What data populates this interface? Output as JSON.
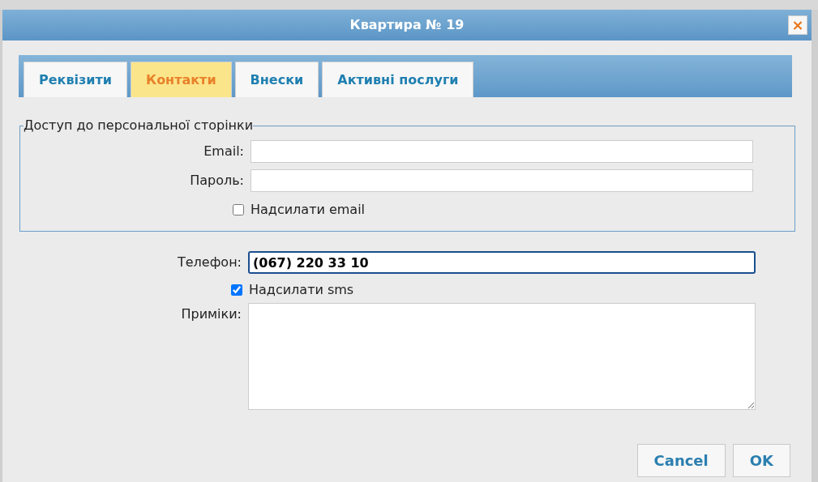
{
  "window": {
    "title": "Квартира № 19",
    "close_icon": "×"
  },
  "tabs": [
    {
      "label": "Реквізити",
      "selected": false
    },
    {
      "label": "Контакти",
      "selected": true
    },
    {
      "label": "Внески",
      "selected": false
    },
    {
      "label": "Активні послуги",
      "selected": false
    }
  ],
  "access_group": {
    "legend": "Доступ до персональної сторінки",
    "fields": [
      {
        "label": "Email:"
      },
      {
        "label": "Пароль:"
      }
    ],
    "checkbox": {
      "label": "Надсилати email",
      "checked": false
    }
  },
  "phone": {
    "label": "Телефон:",
    "value": "(067) 220 33 10",
    "focused": true
  },
  "sms_checkbox": {
    "label": "Надсилати sms",
    "checked": true
  },
  "notes": {
    "label": "Приміки:"
  },
  "buttons": [
    {
      "label": "Cancel"
    },
    {
      "label": "OK"
    }
  ]
}
